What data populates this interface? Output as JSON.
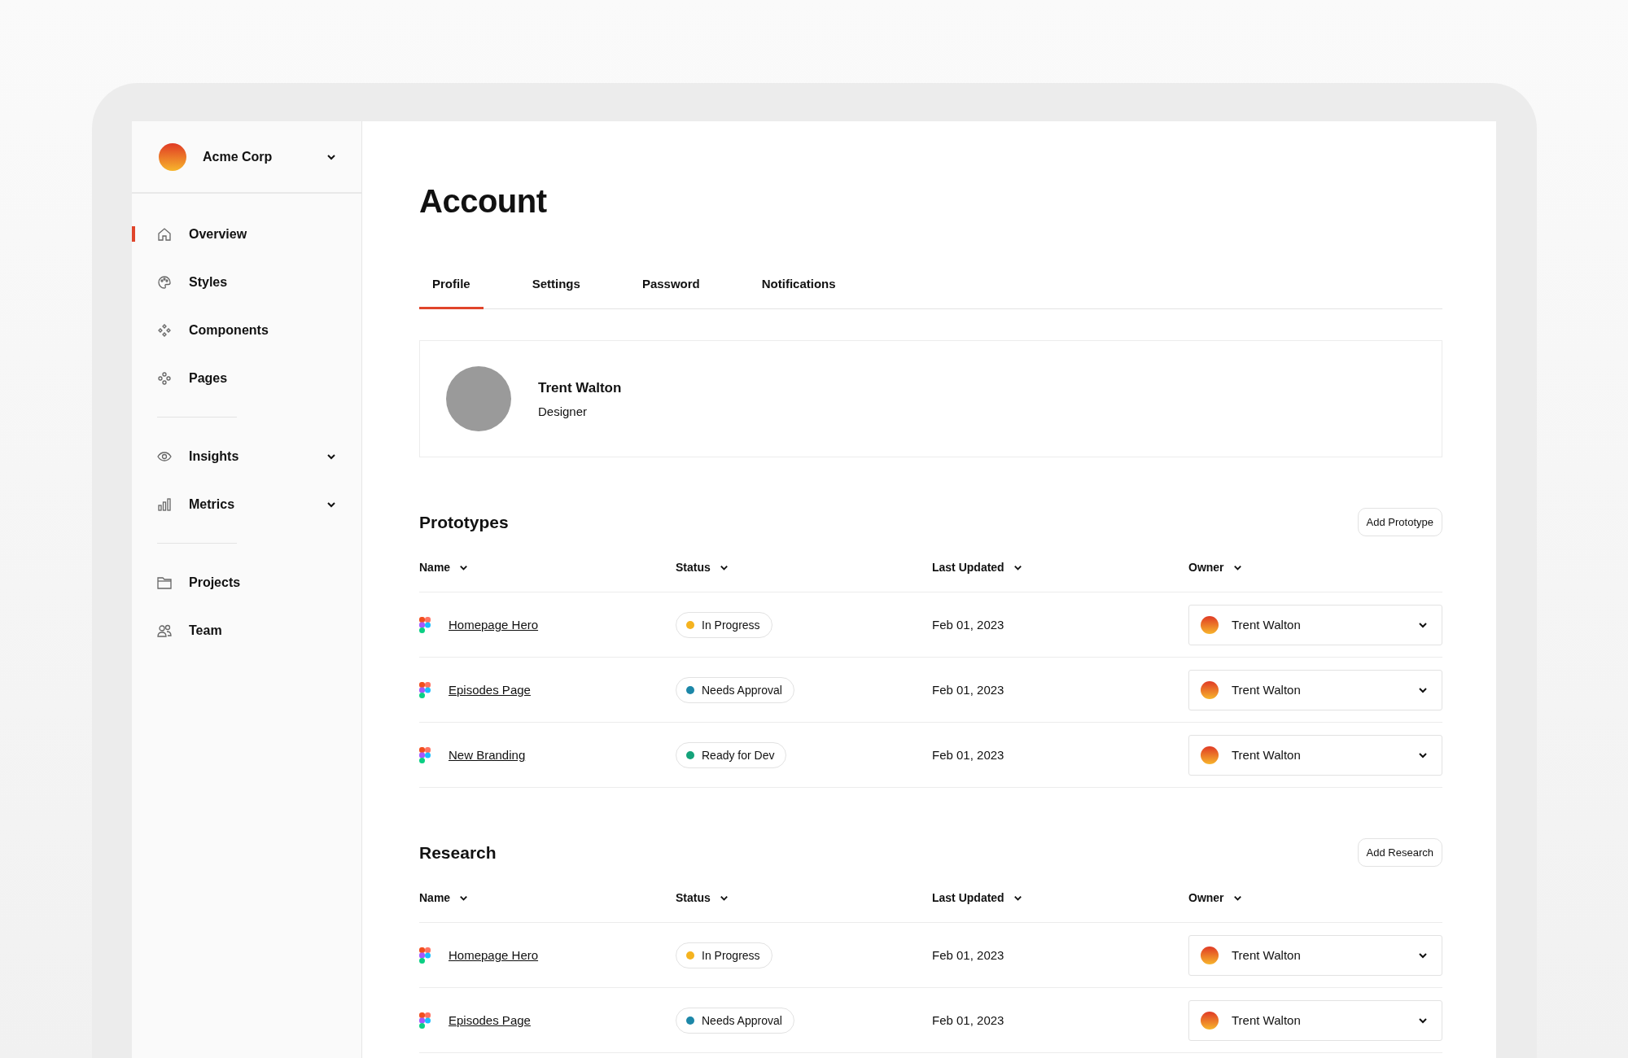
{
  "org": {
    "name": "Acme Corp"
  },
  "sidebar": {
    "groups": [
      {
        "items": [
          {
            "label": "Overview",
            "selected": true,
            "expandable": false
          },
          {
            "label": "Styles",
            "selected": false,
            "expandable": false
          },
          {
            "label": "Components",
            "selected": false,
            "expandable": false
          },
          {
            "label": "Pages",
            "selected": false,
            "expandable": false
          }
        ]
      },
      {
        "items": [
          {
            "label": "Insights",
            "selected": false,
            "expandable": true
          },
          {
            "label": "Metrics",
            "selected": false,
            "expandable": true
          }
        ]
      },
      {
        "items": [
          {
            "label": "Projects",
            "selected": false,
            "expandable": false
          },
          {
            "label": "Team",
            "selected": false,
            "expandable": false
          }
        ]
      }
    ]
  },
  "page": {
    "title": "Account"
  },
  "tabs": [
    {
      "label": "Profile",
      "selected": true
    },
    {
      "label": "Settings",
      "selected": false
    },
    {
      "label": "Password",
      "selected": false
    },
    {
      "label": "Notifications",
      "selected": false
    }
  ],
  "profile": {
    "name": "Trent Walton",
    "role": "Designer"
  },
  "sections": [
    {
      "title": "Prototypes",
      "button": "Add Prototype",
      "columns": [
        "Name",
        "Status",
        "Last Updated",
        "Owner"
      ],
      "rows": [
        {
          "name": "Homepage Hero",
          "status": "In Progress",
          "color": "#f5b31f",
          "updated": "Feb 01, 2023",
          "owner": "Trent Walton"
        },
        {
          "name": "Episodes Page",
          "status": "Needs Approval",
          "color": "#1c87a8",
          "updated": "Feb 01, 2023",
          "owner": "Trent Walton"
        },
        {
          "name": "New Branding",
          "status": "Ready for Dev",
          "color": "#14a37a",
          "updated": "Feb 01, 2023",
          "owner": "Trent Walton"
        }
      ]
    },
    {
      "title": "Research",
      "button": "Add Research",
      "columns": [
        "Name",
        "Status",
        "Last Updated",
        "Owner"
      ],
      "rows": [
        {
          "name": "Homepage Hero",
          "status": "In Progress",
          "color": "#f5b31f",
          "updated": "Feb 01, 2023",
          "owner": "Trent Walton"
        },
        {
          "name": "Episodes Page",
          "status": "Needs Approval",
          "color": "#1c87a8",
          "updated": "Feb 01, 2023",
          "owner": "Trent Walton"
        }
      ]
    }
  ]
}
